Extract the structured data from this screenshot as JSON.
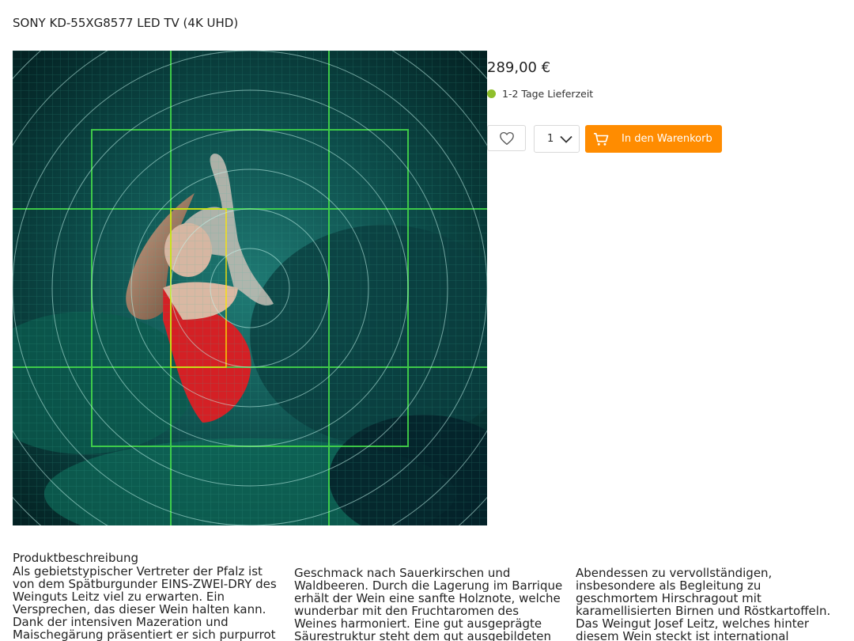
{
  "product": {
    "title": "SONY KD-55XG8577 LED TV (4K UHD)",
    "price": "289,00 €",
    "delivery_text": "1-2 Tage Lieferzeit",
    "delivery_color": "#8fbf2b",
    "quantity": "1",
    "cart_label": "In den Warenkorb",
    "accent_color": "#ff8c00"
  },
  "icons": {
    "wishlist": "heart-icon",
    "quantity_dropdown": "chevron-down-icon",
    "cart": "shopping-cart-icon"
  },
  "description": {
    "heading": "Produktbeschreibung",
    "col1": "Als gebietstypischer Vertreter der Pfalz ist von dem Spätburgunder EINS-ZWEI-DRY des Weinguts Leitz viel zu erwarten. Ein Versprechen, das dieser Wein halten kann. Dank der intensiven Mazeration und Maischegärung präsentiert er sich purpurrot",
    "col2": "Geschmack nach Sauerkirschen und Waldbeeren. Durch die Lagerung im Barrique erhält der Wein eine sanfte Holznote, welche wunderbar mit den Fruchtaromen des Weines harmoniert. Eine gut ausgeprägte Säurestruktur steht dem gut ausgebildeten",
    "col3": "Abendessen zu vervollständigen, insbesondere als Begleitung zu geschmortem Hirschragout mit karamellisierten Birnen und Röstkartoffeln. Das Weingut Josef Leitz, welches hinter diesem Wein steckt ist international anerkannt und renommiert. Es"
  }
}
